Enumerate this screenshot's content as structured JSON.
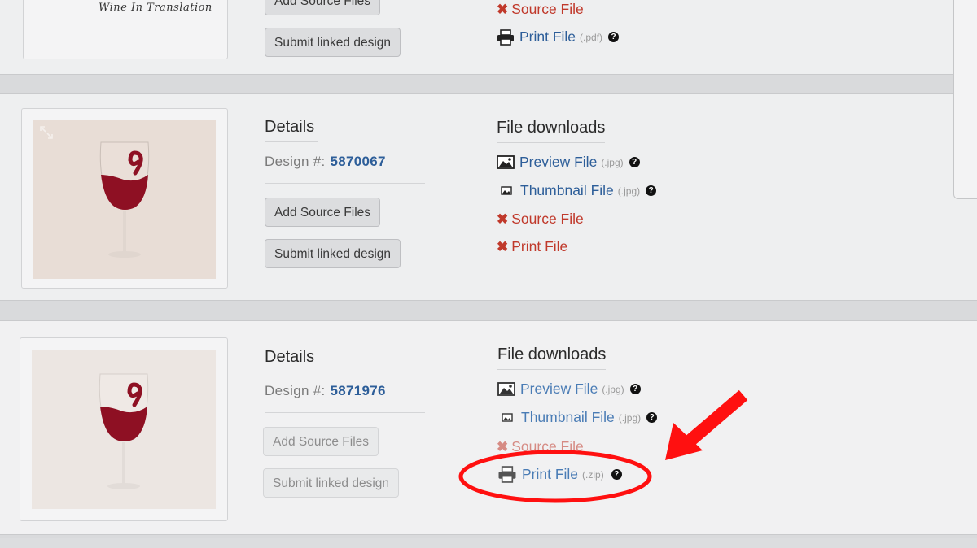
{
  "labels": {
    "details": "Details",
    "design_prefix": "Design #:",
    "file_downloads": "File downloads",
    "add_source": "Add Source Files",
    "submit_linked": "Submit linked design"
  },
  "card0": {
    "logo_text": "Wine In Translation",
    "downloads": {
      "source": "Source File",
      "print": "Print File",
      "print_ext": "(.pdf)"
    }
  },
  "card1": {
    "design_number": "5870067",
    "downloads": {
      "preview": "Preview File",
      "preview_ext": "(.jpg)",
      "thumbnail": "Thumbnail File",
      "thumbnail_ext": "(.jpg)",
      "source": "Source File",
      "print": "Print File"
    }
  },
  "card2": {
    "design_number": "5871976",
    "downloads": {
      "preview": "Preview File",
      "preview_ext": "(.jpg)",
      "thumbnail": "Thumbnail File",
      "thumbnail_ext": "(.jpg)",
      "source": "Source File",
      "print": "Print File",
      "print_ext": "(.zip)"
    }
  },
  "help_glyph": "?",
  "colors": {
    "link": "#2d5e99",
    "missing": "#c0392b",
    "annotation": "#ff1010",
    "wine": "#8e1023"
  },
  "icons": [
    "image-icon",
    "print-icon",
    "x-icon",
    "help-icon",
    "arrow-annotation",
    "circle-annotation"
  ]
}
